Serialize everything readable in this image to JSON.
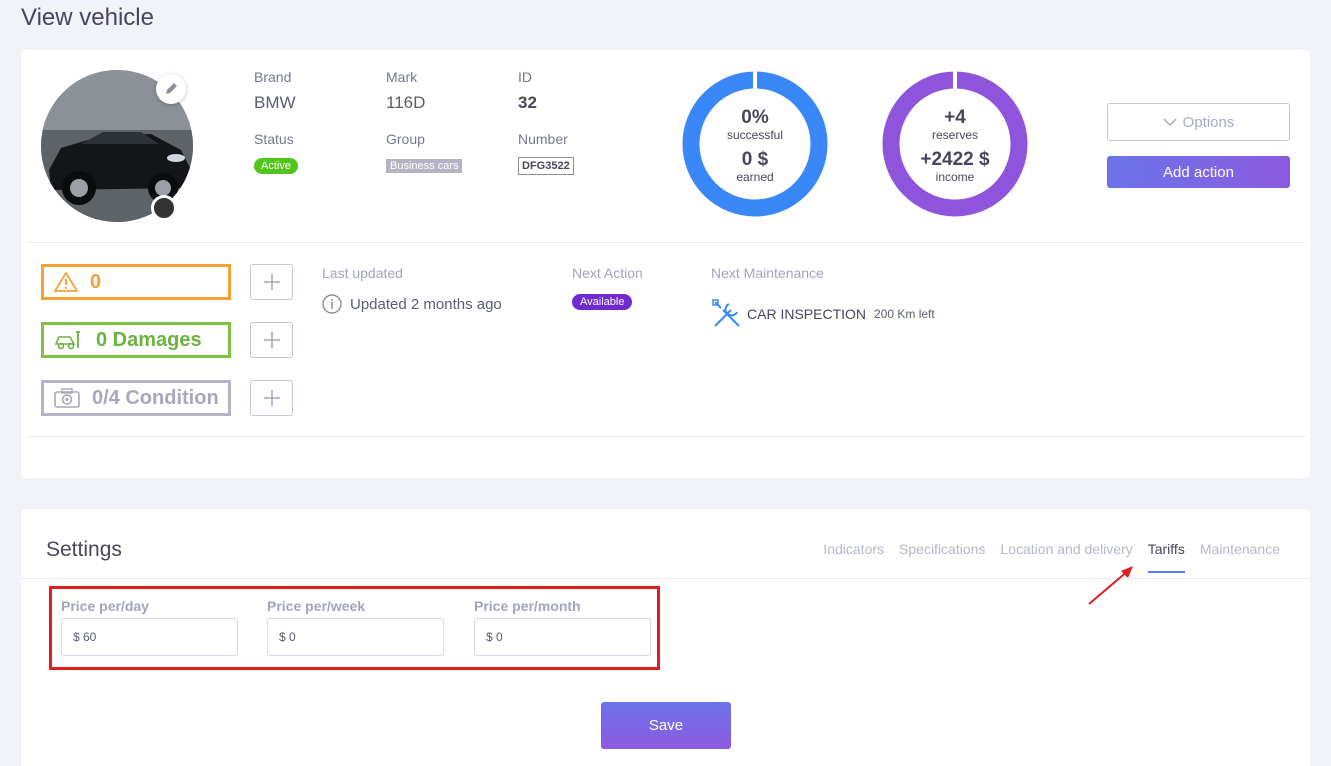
{
  "page": {
    "title": "View vehicle"
  },
  "vehicle": {
    "brand_label": "Brand",
    "brand": "BMW",
    "mark_label": "Mark",
    "mark": "116D",
    "id_label": "ID",
    "id": "32",
    "status_label": "Status",
    "status": "Active",
    "group_label": "Group",
    "group": "Business cars",
    "number_label": "Number",
    "number": "DFG3522"
  },
  "rings": {
    "left": {
      "top_value": "0%",
      "top_caption": "successful",
      "bottom_value": "0 $",
      "bottom_caption": "earned",
      "color": "#3a87f7"
    },
    "right": {
      "top_value": "+4",
      "top_caption": "reserves",
      "bottom_value": "+2422 $",
      "bottom_caption": "income",
      "color": "#8e55dc"
    }
  },
  "actions": {
    "options_label": "Options",
    "add_action_label": "Add action"
  },
  "stats": {
    "warnings": "0",
    "damages": "0  Damages",
    "condition": "0/4  Condition"
  },
  "info": {
    "last_updated_label": "Last updated",
    "last_updated_value": "Updated 2 months ago",
    "next_action_label": "Next Action",
    "next_action_value": "Available",
    "next_maintenance_label": "Next Maintenance",
    "maintenance_name": "CAR INSPECTION",
    "maintenance_left": "200 Km left"
  },
  "settings": {
    "title": "Settings",
    "tabs": [
      {
        "label": "Indicators"
      },
      {
        "label": "Specifications"
      },
      {
        "label": "Location and delivery"
      },
      {
        "label": "Tariffs"
      },
      {
        "label": "Maintenance"
      }
    ],
    "active_tab": "Tariffs",
    "price_day_label": "Price per/day",
    "price_day_value": "$ 60",
    "price_week_label": "Price per/week",
    "price_week_value": "$ 0",
    "price_month_label": "Price per/month",
    "price_month_value": "$ 0",
    "save_label": "Save"
  },
  "colors": {
    "accent": "#5d78ff",
    "warning": "#f4a236",
    "success": "#6cb33f",
    "highlight": "#e21d1d"
  }
}
